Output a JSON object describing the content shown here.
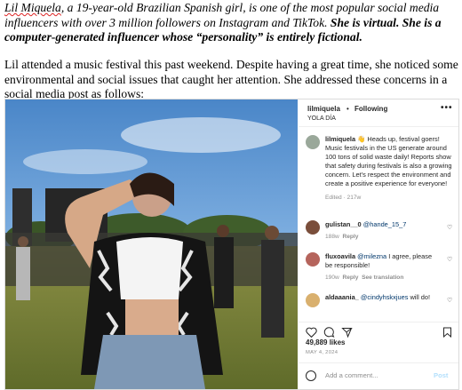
{
  "paragraph1": {
    "name": "Lil Miquela",
    "text_a": ", a 19-year-old Brazilian Spanish girl, is one of the most popular social media influencers with over 3 million followers on Instagram and TikTok.",
    "text_b": " She is virtual. She is a computer-generated influencer whose “personality” is entirely fictional."
  },
  "paragraph2": "Lil attended a music festival this past weekend. Despite having a great time, she noticed some environmental and social issues that caught her attention. She addressed these concerns in a social media post as follows:",
  "post": {
    "username": "lilmiquela",
    "dot": "•",
    "follow_label": "Following",
    "location": "YOLA DÍA",
    "more_icon": "•••",
    "caption_user": "lilmiquela",
    "caption": " 👋 Heads up, festival goers! Music festivals in the US generate around 100 tons of solid waste daily! Reports show that safety during festivals is also a growing concern. Let's respect the environment and create a positive experience for everyone!",
    "caption_meta": "Edited · 217w",
    "comments": [
      {
        "user": "gulistan__0",
        "mention": "@hande_15_7",
        "text": "",
        "time": "188w",
        "reply": "Reply",
        "extra": ""
      },
      {
        "user": "fluxoavila",
        "mention": "@milezna",
        "text": " I agree, please be responsible!",
        "time": "190w",
        "reply": "Reply",
        "extra": "See translation"
      },
      {
        "user": "aldaaania_",
        "mention": "@cindyhskxjues",
        "text": " will do!",
        "time": "",
        "reply": "",
        "extra": ""
      }
    ],
    "likes": "49,889 likes",
    "date": "MAY 4, 2024",
    "add_comment_placeholder": "Add a comment...",
    "post_button": "Post"
  },
  "colors": {
    "link": "#00376b",
    "meta": "#8e8e8e",
    "post_button": "#b2dffc"
  }
}
